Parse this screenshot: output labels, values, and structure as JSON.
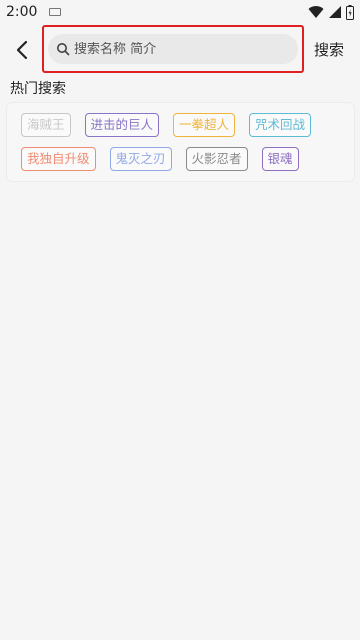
{
  "statusbar": {
    "time": "2:00"
  },
  "header": {
    "search_placeholder": "搜索名称 简介",
    "search_value": "",
    "search_button_label": "搜索"
  },
  "hot": {
    "title": "热门搜索",
    "tags": [
      {
        "label": "海贼王",
        "color": "#c8c8c8"
      },
      {
        "label": "进击的巨人",
        "color": "#8a74c7"
      },
      {
        "label": "一拳超人",
        "color": "#f0b43a"
      },
      {
        "label": "咒术回战",
        "color": "#5dbbd6"
      },
      {
        "label": "我独自升级",
        "color": "#ef8d73"
      },
      {
        "label": "鬼灭之刃",
        "color": "#90a8e6"
      },
      {
        "label": "火影忍者",
        "color": "#8a8a8a"
      },
      {
        "label": "银魂",
        "color": "#8e6fc2"
      }
    ]
  },
  "colors": {
    "highlight": "#e02020",
    "search_bg": "#e9e9e9"
  }
}
